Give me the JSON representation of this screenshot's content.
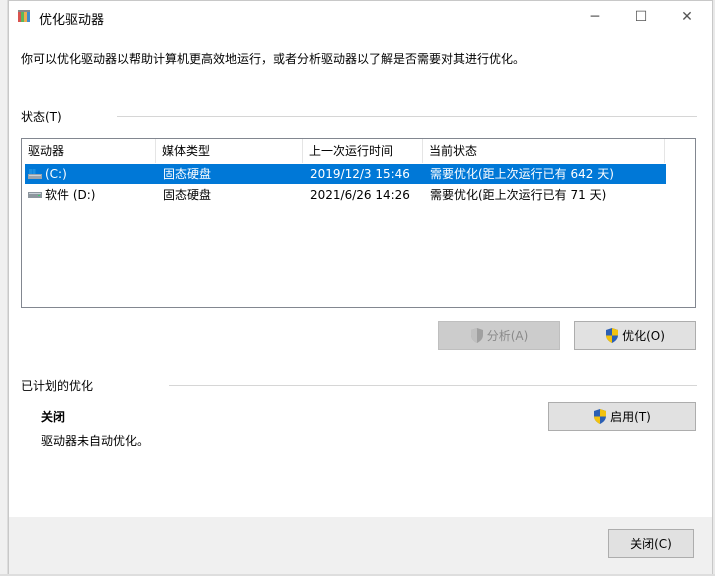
{
  "window": {
    "title": "优化驱动器",
    "controls": {
      "minimize": "─",
      "maximize": "☐",
      "close": "✕"
    }
  },
  "intro_text": "你可以优化驱动器以帮助计算机更高效地运行，或者分析驱动器以了解是否需要对其进行优化。",
  "status": {
    "label": "状态(T)",
    "columns": [
      "驱动器",
      "媒体类型",
      "上一次运行时间",
      "当前状态"
    ],
    "rows": [
      {
        "drive": "(C:)",
        "media": "固态硬盘",
        "last_run": "2019/12/3 15:46",
        "state": "需要优化(距上次运行已有 642 天)",
        "selected": true,
        "icon": "drive-c-icon"
      },
      {
        "drive": "软件 (D:)",
        "media": "固态硬盘",
        "last_run": "2021/6/26 14:26",
        "state": "需要优化(距上次运行已有 71 天)",
        "selected": false,
        "icon": "drive-icon"
      }
    ],
    "analyze_button": "分析(A)",
    "optimize_button": "优化(O)"
  },
  "scheduled": {
    "label": "已计划的优化",
    "state": "关闭",
    "description": "驱动器未自动优化。",
    "enable_button": "启用(T)"
  },
  "footer": {
    "close_button": "关闭(C)"
  },
  "colors": {
    "selection": "#0078d7",
    "shield_blue": "#2b5fb4",
    "shield_yellow": "#f2c20f"
  }
}
